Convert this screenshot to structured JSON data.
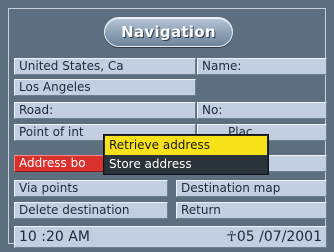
{
  "title": "Navigation",
  "fields": {
    "country": "United States, Ca",
    "name": "Name:",
    "city": "Los Angeles",
    "road": "Road:",
    "number": "No:",
    "point_of_interest": "Point of int",
    "place": "Plac",
    "address_book": "Address bo",
    "via_points": "Via points",
    "destination_map": "Destination map",
    "delete_destination": "Delete destination",
    "return": "Return"
  },
  "popup_menu": {
    "items": [
      "Retrieve address",
      "Store address"
    ],
    "selected_index": 0
  },
  "status": {
    "time": "10 :20 AM",
    "date": "☥05 /07/2001"
  },
  "colors": {
    "background": "#5d6f7f",
    "field": "#c2cfe0",
    "field_active": "#d9312e",
    "popup_highlight": "#f7e21a",
    "popup_background": "#2b333a"
  }
}
